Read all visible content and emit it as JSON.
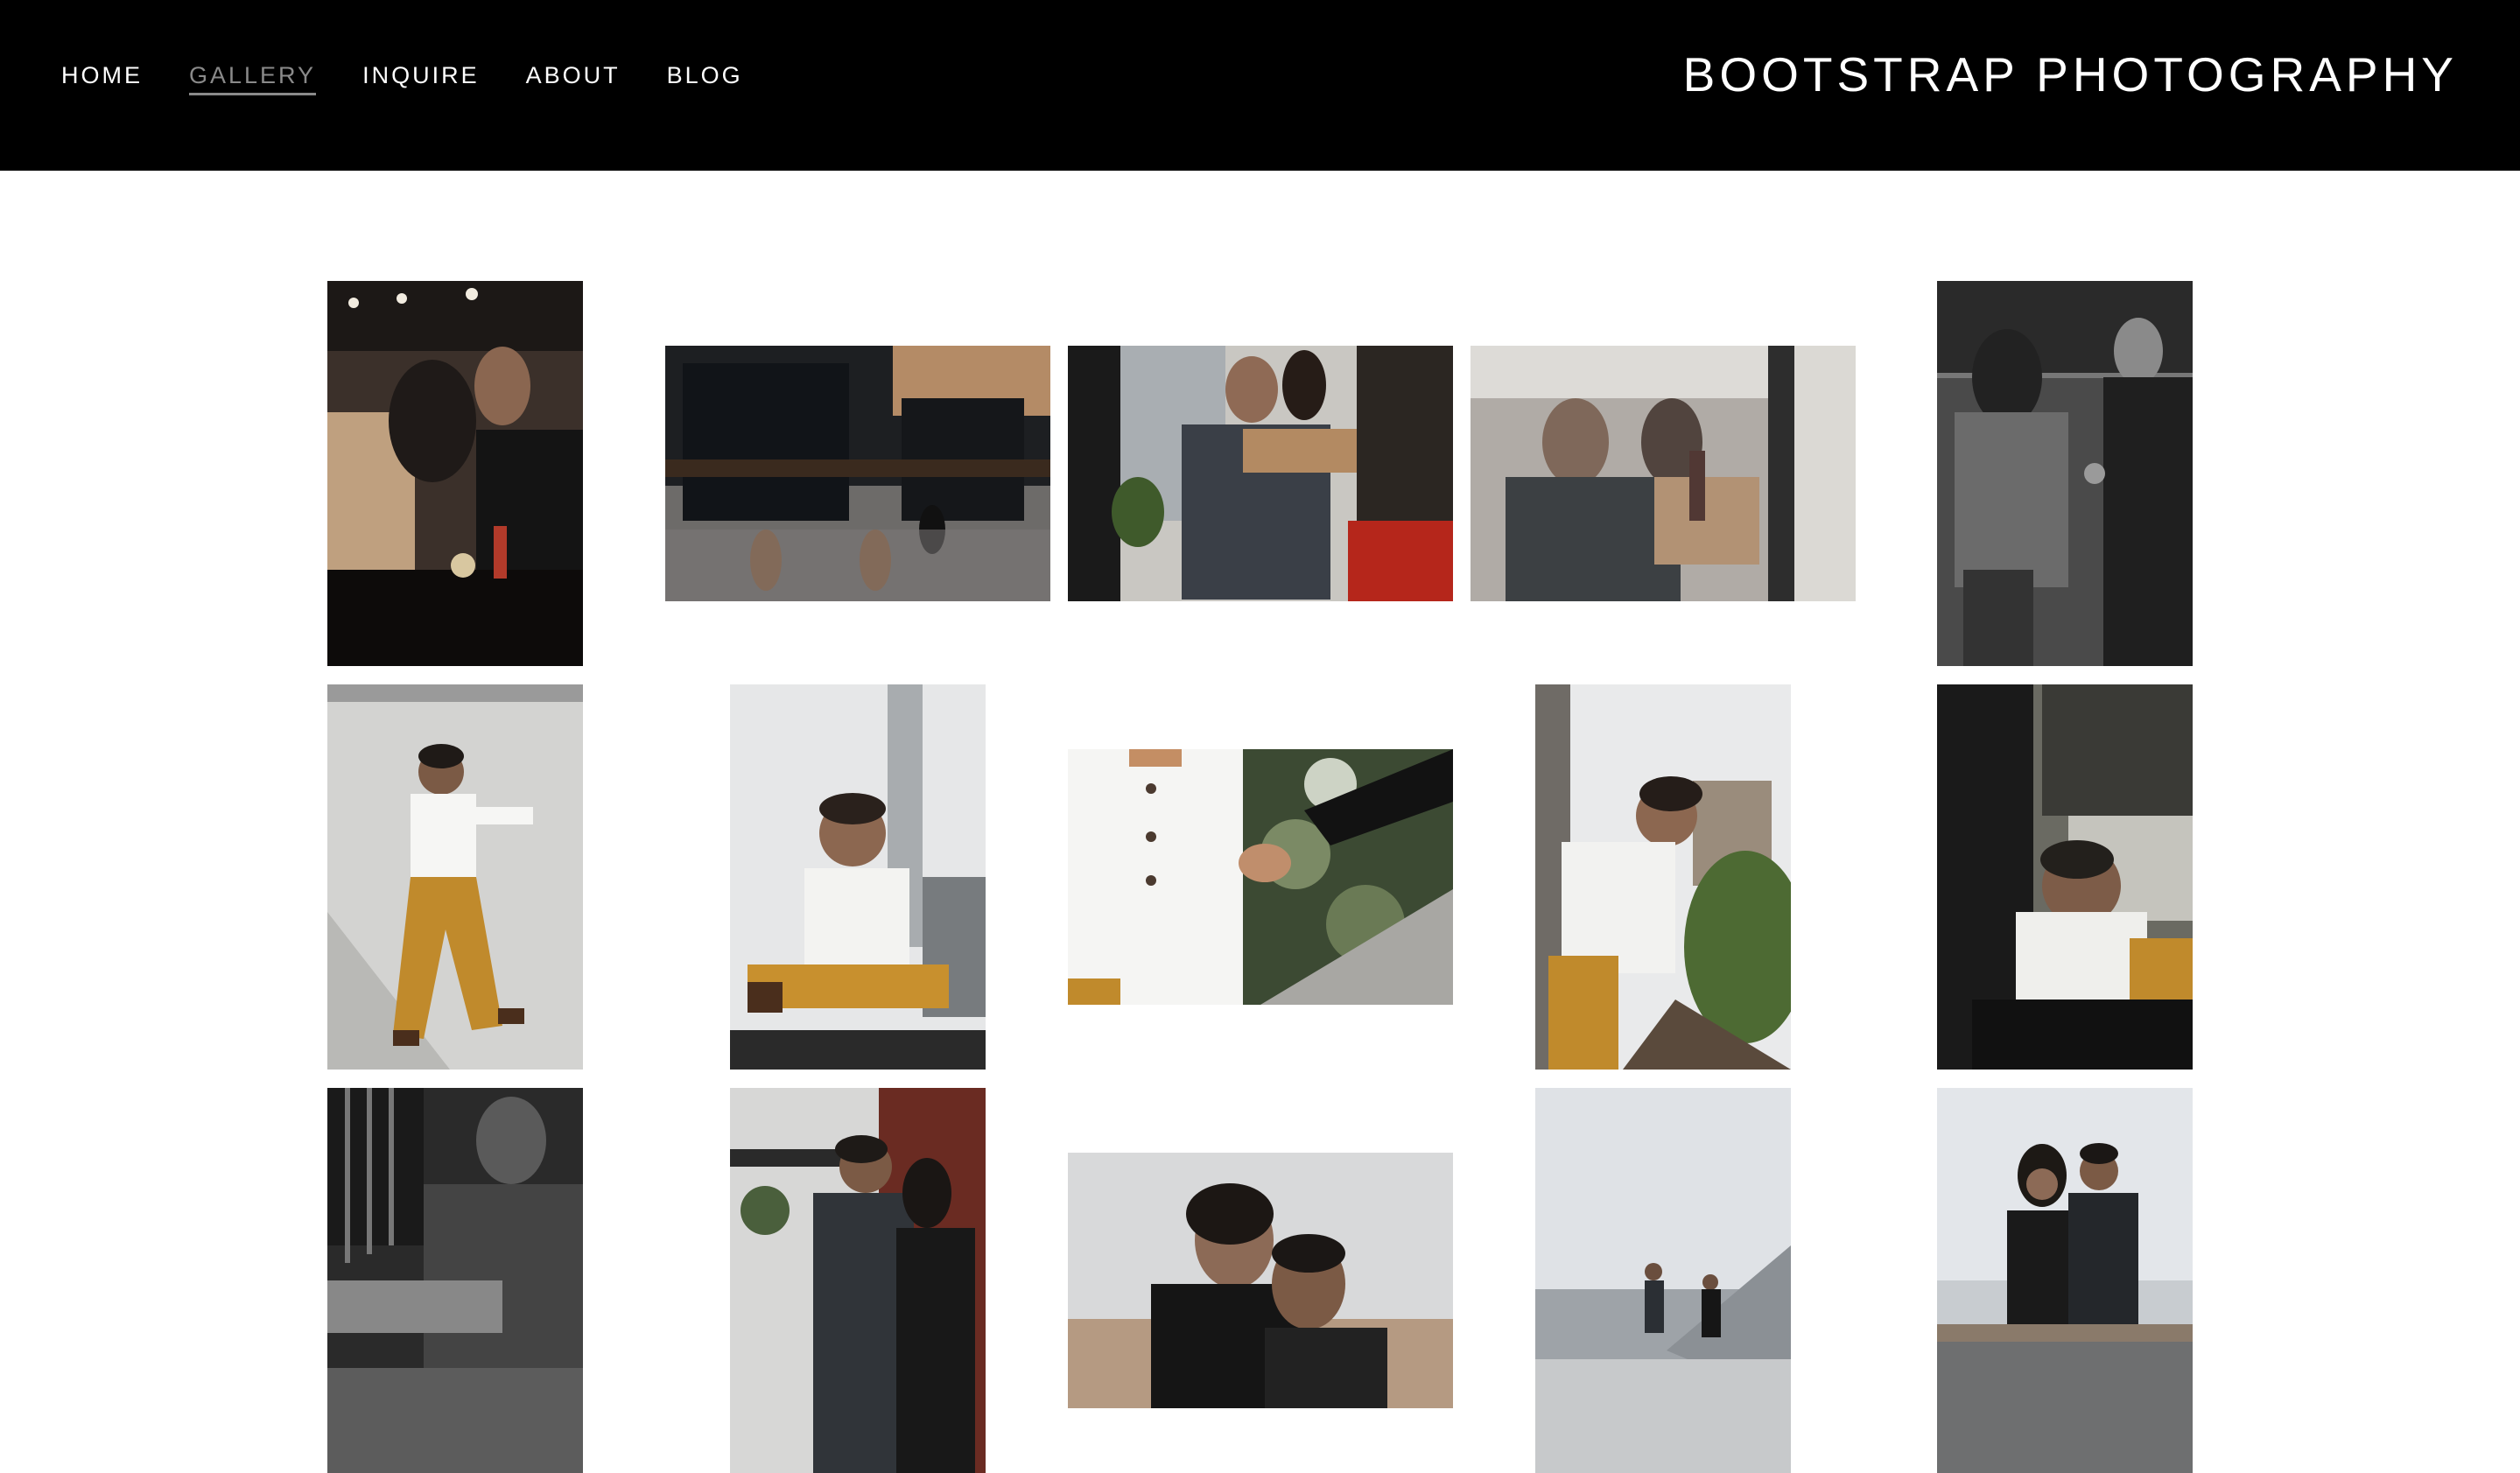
{
  "nav": {
    "items": [
      {
        "label": "HOME",
        "active": false
      },
      {
        "label": "GALLERY",
        "active": true
      },
      {
        "label": "INQUIRE",
        "active": false
      },
      {
        "label": "ABOUT",
        "active": false
      },
      {
        "label": "BLOG",
        "active": false
      }
    ]
  },
  "brand": {
    "title": "BOOTSTRAP PHOTOGRAPHY"
  },
  "colors": {
    "header_bg": "#000000",
    "nav_text": "#ffffff",
    "nav_active": "#8a8a8a",
    "page_bg": "#ffffff"
  },
  "gallery": {
    "photos": [
      {
        "name": "couple-kissing-cafe"
      },
      {
        "name": "couple-legs-bench"
      },
      {
        "name": "couple-hug-smiling-chair"
      },
      {
        "name": "couple-window-reflection"
      },
      {
        "name": "couple-bw-window"
      },
      {
        "name": "boy-wall-lean"
      },
      {
        "name": "boy-sitting-smile"
      },
      {
        "name": "boy-holding-hand"
      },
      {
        "name": "boy-rail-climbing"
      },
      {
        "name": "boy-bw-hug-mom"
      },
      {
        "name": "man-bw-stairs"
      },
      {
        "name": "couple-hug-brick-building"
      },
      {
        "name": "couple-hug-closeup"
      },
      {
        "name": "couple-walking-rooftop"
      },
      {
        "name": "couple-sitting-ledge"
      }
    ]
  }
}
